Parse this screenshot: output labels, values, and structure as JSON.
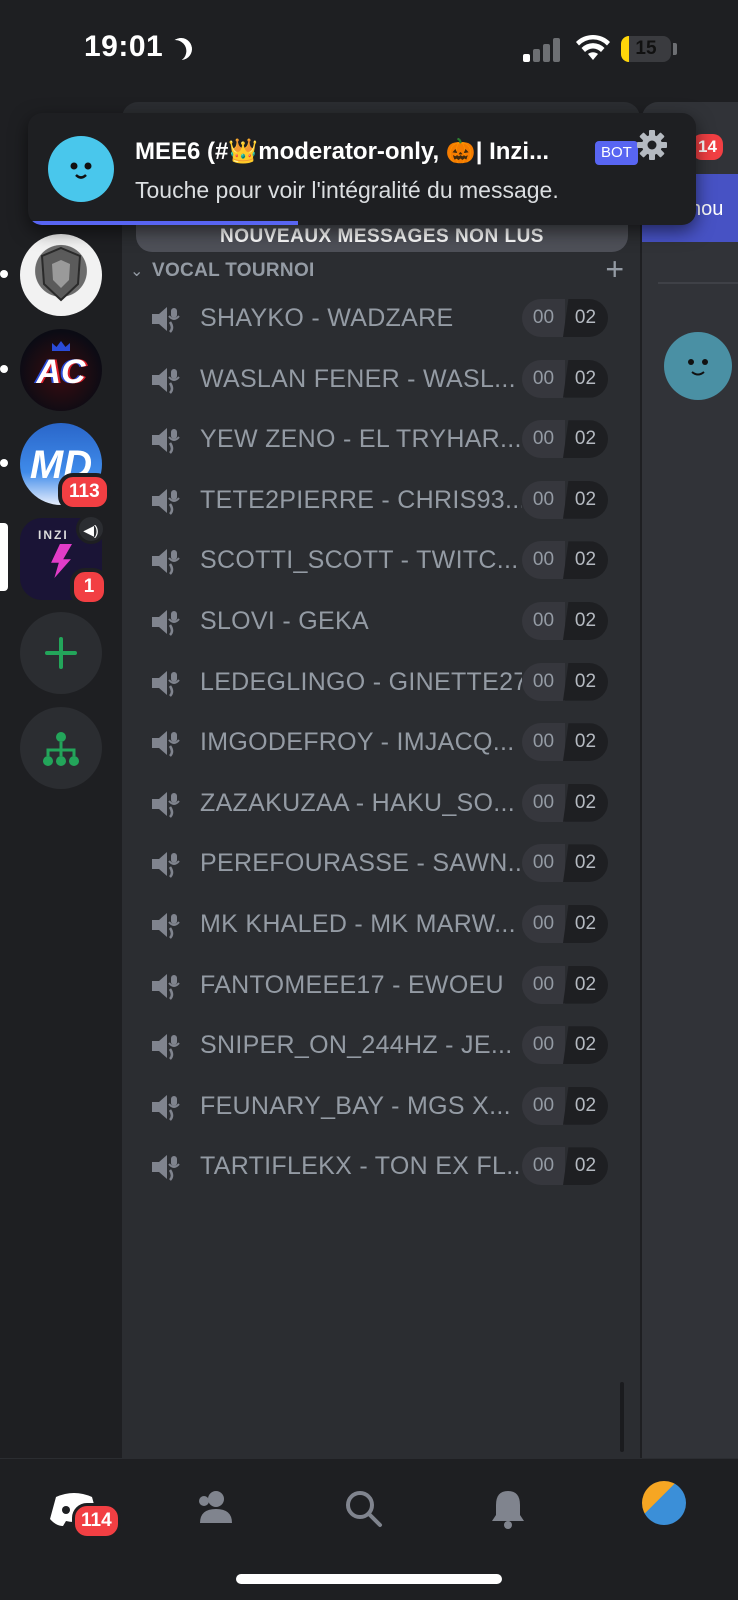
{
  "status_bar": {
    "time": "19:01",
    "battery": "15",
    "battery_level": 0.15,
    "icons": [
      "moon-icon",
      "signal-icon",
      "wifi-icon",
      "battery-icon"
    ]
  },
  "notification": {
    "title": "MEE6 (#👑moderator-only, 🎃| Inzi...",
    "bot_tag": "BOT",
    "body": "Touche pour voir l'intégralité du message.",
    "icon": "gear-icon"
  },
  "servers": [
    {
      "name": "server-badge",
      "badge": ""
    },
    {
      "name": "server-ac",
      "initials": "AC",
      "badge": ""
    },
    {
      "name": "server-md",
      "initials": "MD",
      "badge": "113"
    },
    {
      "name": "server-inzi",
      "initials": "INZI",
      "badge": "1"
    }
  ],
  "rail_actions": [
    "add-server-icon",
    "discover-icon"
  ],
  "panel": {
    "new_messages_banner": "NOUVEAUX MESSAGES NON LUS",
    "category": "VOCAL TOURNOI",
    "channels": [
      {
        "name": "SHAYKO - WADZARE",
        "current": "00",
        "limit": "02"
      },
      {
        "name": "WASLAN FENER - WASL...",
        "current": "00",
        "limit": "02"
      },
      {
        "name": "YEW ZENO - EL TRYHAR...",
        "current": "00",
        "limit": "02"
      },
      {
        "name": "TETE2PIERRE - CHRIS93...",
        "current": "00",
        "limit": "02"
      },
      {
        "name": "SCOTTI_SCOTT - TWITC...",
        "current": "00",
        "limit": "02"
      },
      {
        "name": "SLOVI - GEKA",
        "current": "00",
        "limit": "02"
      },
      {
        "name": "LEDEGLINGO - GINETTE27",
        "current": "00",
        "limit": "02"
      },
      {
        "name": "IMGODEFROY - IMJACQ...",
        "current": "00",
        "limit": "02"
      },
      {
        "name": "ZAZAKUZAA - HAKU_SO...",
        "current": "00",
        "limit": "02"
      },
      {
        "name": "PEREFOURASSE - SAWN...",
        "current": "00",
        "limit": "02"
      },
      {
        "name": "MK KHALED - MK MARW...",
        "current": "00",
        "limit": "02"
      },
      {
        "name": "FANTOMEEE17 - EWOEU",
        "current": "00",
        "limit": "02"
      },
      {
        "name": "SNIPER_ON_244HZ - JE...",
        "current": "00",
        "limit": "02"
      },
      {
        "name": "FEUNARY_BAY - MGS X...",
        "current": "00",
        "limit": "02"
      },
      {
        "name": "TARTIFLEKX - TON EX FL...",
        "current": "00",
        "limit": "02"
      }
    ]
  },
  "right_peek": {
    "badge": "14",
    "banner_text": "nou"
  },
  "bottom_nav": {
    "home_badge": "114",
    "items": [
      "home-icon",
      "friends-icon",
      "search-icon",
      "notifications-icon",
      "profile-avatar"
    ]
  },
  "colors": {
    "background": "#1e1f22",
    "panel": "#2b2d31",
    "accent": "#5865f2",
    "danger": "#f23f43",
    "green": "#23a55a"
  }
}
